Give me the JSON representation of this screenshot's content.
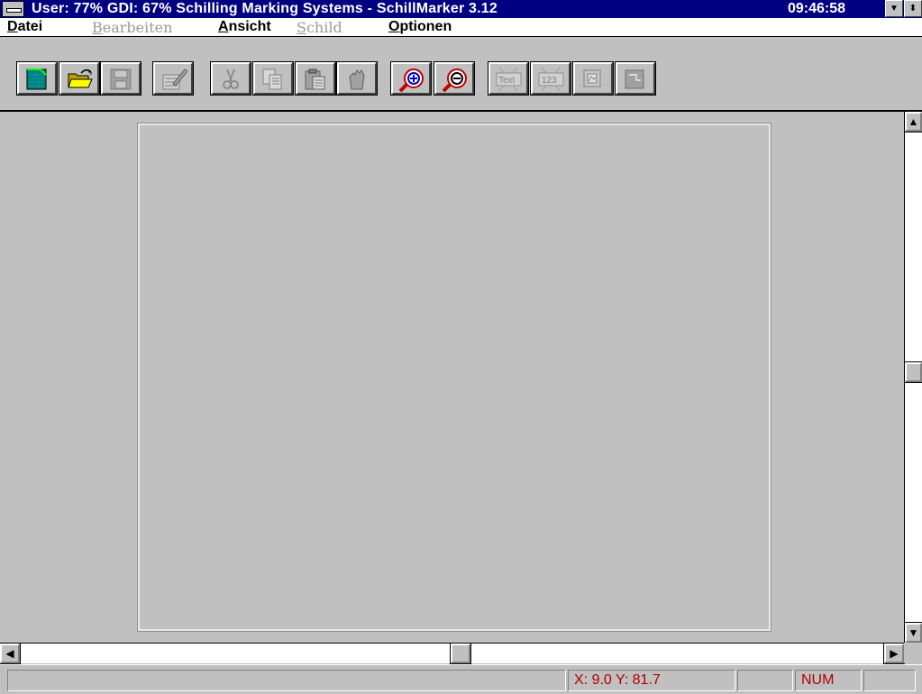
{
  "titlebar": {
    "title": "User: 77% GDI: 67%  Schilling Marking Systems - SchillMarker 3.12",
    "clock": "09:46:58",
    "minimize_glyph": "▼",
    "restore_glyph": "⬍"
  },
  "menu": {
    "datei": {
      "key": "D",
      "rest": "atei"
    },
    "bearbeiten": {
      "key": "B",
      "rest": "earbeiten"
    },
    "ansicht": {
      "key": "A",
      "rest": "nsicht"
    },
    "schild": {
      "key": "S",
      "rest": "child"
    },
    "optionen": {
      "key": "O",
      "rest": "ptionen"
    }
  },
  "toolbar": {
    "text_label": "Text",
    "number_label": "123"
  },
  "scrollbars": {
    "up_glyph": "▲",
    "down_glyph": "▼",
    "left_glyph": "◀",
    "right_glyph": "▶",
    "vertical_position": 0.49,
    "horizontal_position": 0.51
  },
  "status": {
    "coordinates": "X: 9.0  Y: 81.7",
    "num": "NUM"
  },
  "colors": {
    "title_bar": "#000080",
    "window_bg": "#c0c0c0",
    "status_text": "#b00000"
  }
}
